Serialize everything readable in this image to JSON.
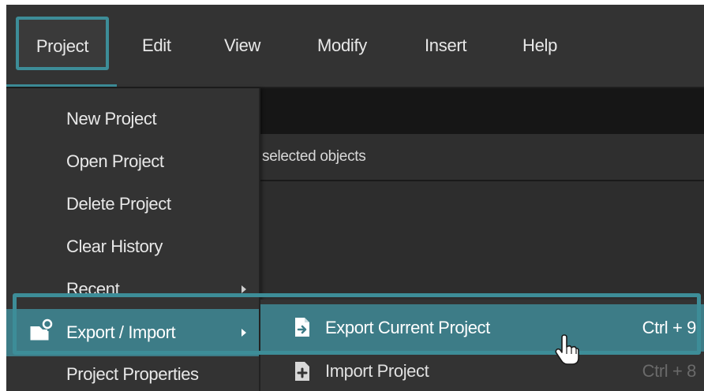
{
  "menubar": {
    "items": [
      {
        "label": "Project"
      },
      {
        "label": "Edit"
      },
      {
        "label": "View"
      },
      {
        "label": "Modify"
      },
      {
        "label": "Insert"
      },
      {
        "label": "Help"
      }
    ]
  },
  "panel": {
    "row_text": "selected objects"
  },
  "project_menu": {
    "items": [
      {
        "label": "New Project"
      },
      {
        "label": "Open Project"
      },
      {
        "label": "Delete Project"
      },
      {
        "label": "Clear History"
      },
      {
        "label": "Recent",
        "has_submenu": true
      },
      {
        "label": "Export / Import",
        "has_submenu": true,
        "icon": "export-import-icon",
        "highlighted": true
      },
      {
        "label": "Project Properties"
      }
    ]
  },
  "export_import_submenu": {
    "items": [
      {
        "label": "Export Current Project",
        "shortcut": "Ctrl + 9",
        "icon": "file-export-icon",
        "highlighted": true
      },
      {
        "label": "Import Project",
        "shortcut": "Ctrl + 8",
        "icon": "file-import-icon"
      }
    ]
  },
  "colors": {
    "accent": "#3d8d98",
    "highlight": "#3d7c87",
    "menu_bg": "#333333",
    "panel_dark": "#161616"
  }
}
